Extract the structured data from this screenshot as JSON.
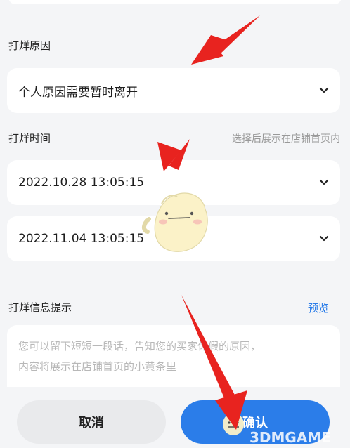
{
  "sections": {
    "reason_label": "打烊原因",
    "reason_value": "个人原因需要暂时离开",
    "time_label": "打烊时间",
    "time_hint": "选择后展示在店铺首页内",
    "start_time": "2022.10.28 13:05:15",
    "end_time": "2022.11.04 13:05:15",
    "info_label": "打烊信息提示",
    "preview_link": "预览",
    "placeholder_line1": "您可以留下短短一段话，告知您的买家休假的原因，",
    "placeholder_line2": "内容将展示在店铺首页的小黄条里"
  },
  "buttons": {
    "cancel": "取消",
    "confirm": "确认"
  },
  "watermark": "3DMGAME",
  "colors": {
    "accent": "#2b7de9",
    "annotation_arrow": "#e8231f"
  }
}
